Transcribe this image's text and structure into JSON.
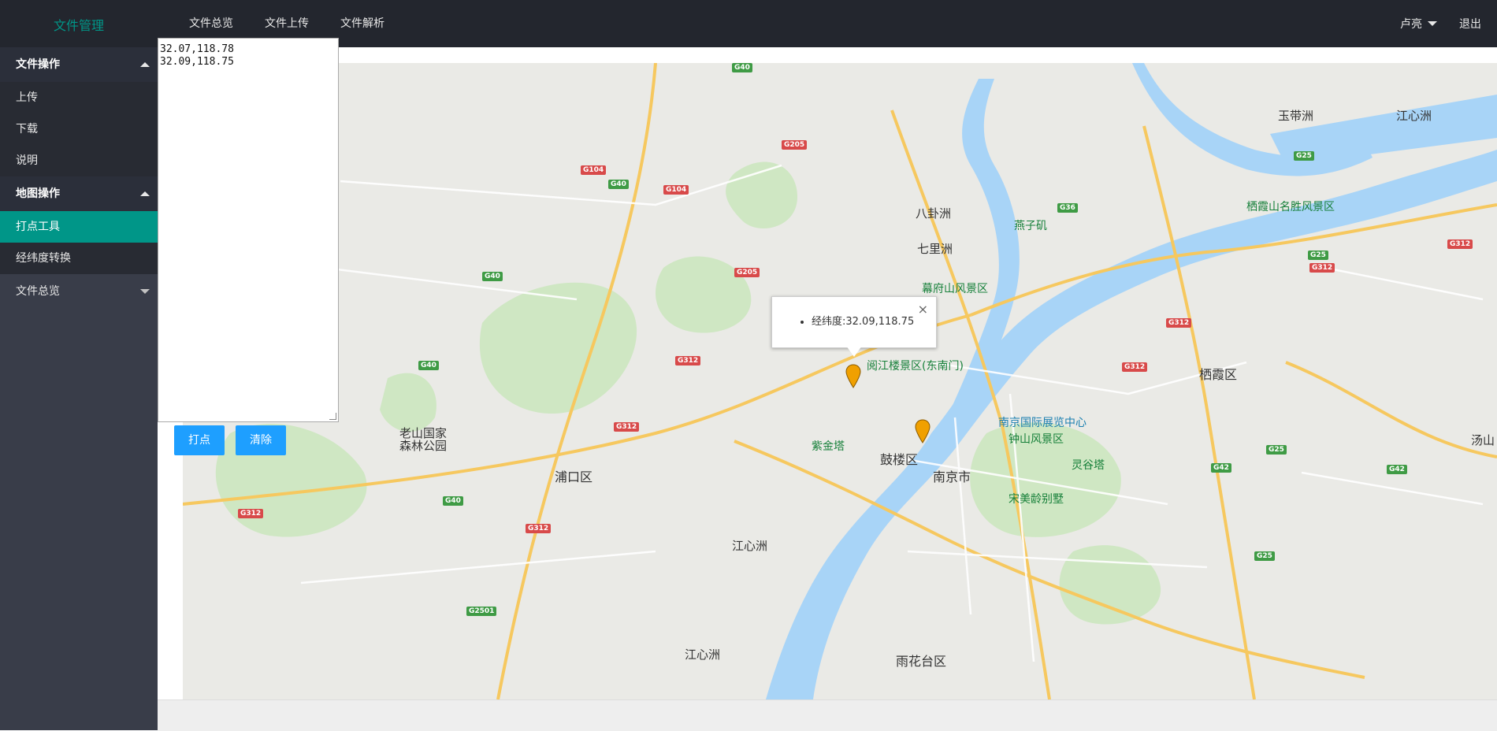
{
  "header": {
    "logo": "文件管理",
    "nav": [
      "文件总览",
      "文件上传",
      "文件解析"
    ],
    "user": "卢亮",
    "logout": "退出"
  },
  "sidebar": {
    "groups": [
      {
        "label": "文件操作",
        "expanded": true,
        "items": [
          "上传",
          "下载",
          "说明"
        ]
      },
      {
        "label": "地图操作",
        "expanded": true,
        "items": [
          "打点工具",
          "经纬度转换"
        ],
        "active_item": "打点工具"
      },
      {
        "label": "文件总览",
        "expanded": false,
        "items": []
      }
    ]
  },
  "tool": {
    "coords": [
      "32.07,118.78",
      "32.09,118.75"
    ],
    "plot_button": "打点",
    "clear_button": "清除"
  },
  "popup": {
    "text": "经纬度:32.09,118.75",
    "close": "×"
  },
  "map": {
    "labels": {
      "nanjing": "南京市",
      "pukou": "浦口区",
      "gulou": "鼓楼区",
      "qixia": "栖霞区",
      "yuhuatai": "雨花台区",
      "jiangxinzhou1": "江心洲",
      "jiangxinzhou2": "江心洲",
      "bagua": "八卦洲",
      "qili": "七里洲",
      "yuedai": "玉带洲",
      "jiangxinzhou3": "江心洲",
      "laoshan": "老山国家\n森林公园",
      "zijin": "紫金塔",
      "zhongshan": "钟山风景区",
      "linggu": "灵谷塔",
      "songmeiling": "宋美龄别墅",
      "yuejiang": "阅江楼景区(东南门)",
      "mufushan": "幕府山风景区",
      "yanziji": "燕子矶",
      "qixiashan": "栖霞山名胜风景区",
      "expo": "南京国际展览中心",
      "tangshan": "汤山"
    },
    "accent": "#009688",
    "button_color": "#1e9fff"
  }
}
